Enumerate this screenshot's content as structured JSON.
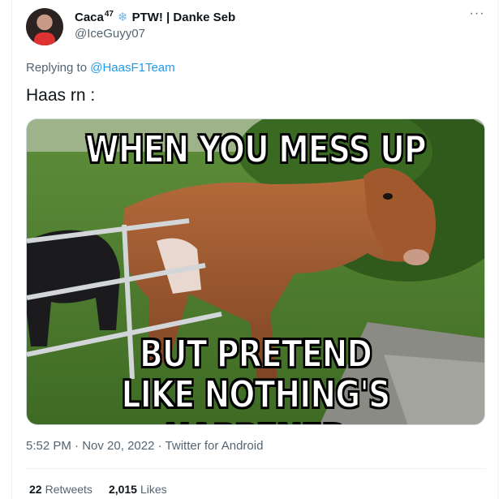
{
  "author": {
    "display_name": "Caca",
    "superscript": "47",
    "name_suffix": "PTW! | Danke Seb",
    "handle": "@IceGuyy07"
  },
  "icons": {
    "snowflake": "snowflake-icon",
    "more": "more-options-icon",
    "avatar": "avatar"
  },
  "more_glyph": "···",
  "snowflake_glyph": "❄",
  "reply": {
    "prefix": "Replying to",
    "target": "@HaasF1Team"
  },
  "tweet_text": "Haas rn :",
  "meme": {
    "top": "WHEN YOU MESS UP",
    "bottom_line_1": "BUT PRETEND",
    "bottom_line_2": "LIKE NOTHING'S HAPPENED"
  },
  "meta": {
    "time": "5:52 PM",
    "sep1": "·",
    "date": "Nov 20, 2022",
    "sep2": "·",
    "source": "Twitter for Android"
  },
  "stats": {
    "retweets_count": "22",
    "retweets_label": "Retweets",
    "likes_count": "2,015",
    "likes_label": "Likes"
  },
  "colors": {
    "link": "#1d9bf0",
    "secondary_text": "#536471",
    "primary_text": "#0f1419",
    "divider": "#eff3f4"
  }
}
